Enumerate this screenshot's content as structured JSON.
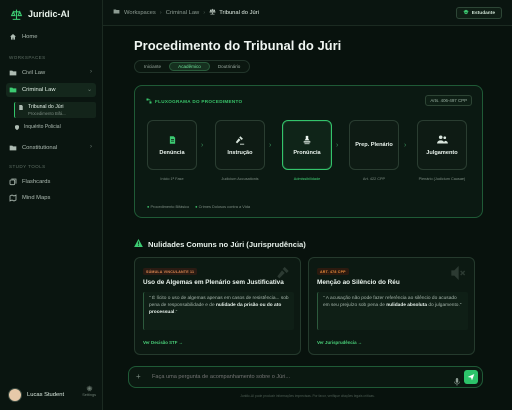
{
  "app": {
    "name": "Juridic-AI"
  },
  "sidebar": {
    "home": "Home",
    "workspaces_label": "WORKSPACES",
    "civil_law": "Civil Law",
    "criminal_law": "Criminal Law",
    "sub_items": [
      {
        "title": "Tribunal do Júri",
        "subtitle": "Procedimento Bifá..."
      },
      {
        "title": "Inquérito Policial",
        "subtitle": ""
      }
    ],
    "constitutional": "Constitutional",
    "study_tools_label": "STUDY TOOLS",
    "flashcards": "Flashcards",
    "mind_maps": "Mind Maps",
    "user_name": "Lucas Student",
    "settings_label": "Settings"
  },
  "topbar": {
    "breadcrumbs": [
      "Workspaces",
      "Criminal Law",
      "Tribunal do Júri"
    ],
    "mode_label": "Estudante"
  },
  "main": {
    "title": "Procedimento do Tribunal do Júri",
    "tabs": [
      {
        "label": "Iniciante",
        "active": false
      },
      {
        "label": "Acadêmico",
        "active": true
      },
      {
        "label": "Doutrinário",
        "active": false
      }
    ],
    "flowchart": {
      "title": "FLUXOGRAMA DO PROCEDIMENTO",
      "ref": "Arts. 406-497 CPP",
      "nodes": [
        {
          "label": "Denúncia",
          "sub": "Início 1ª Fase",
          "icon": "document-icon",
          "highlight": false
        },
        {
          "label": "Instrução",
          "sub": "Judicium Accusationis",
          "icon": "gavel-icon",
          "highlight": false
        },
        {
          "label": "Pronúncia",
          "sub": "Admissibilidade",
          "icon": "stamp-icon",
          "highlight": true
        },
        {
          "label": "Prep. Plenário",
          "sub": "Art. 422 CPP",
          "icon": "",
          "highlight": false
        },
        {
          "label": "Julgamento",
          "sub": "Plenário (Judicium Causae)",
          "icon": "people-icon",
          "highlight": false
        }
      ],
      "legend": [
        "Procedimento Bifásico",
        "Crimes Dolosos contra a Vida"
      ]
    },
    "nullities": {
      "title": "Nulidades Comuns no Júri (Jurisprudência)",
      "cards": [
        {
          "badge": "SÚMULA VINCULANTE 11",
          "title": "Uso de Algemas em Plenário sem Justificativa",
          "quote_pre": "\" É lícito o uso de algemas apenas em casos de resistência... sob pena de responsabilidade e de ",
          "quote_bold": "nulidade da prisão ou do ato processual",
          "quote_post": ".\"",
          "link": "Ver Decisão STF →"
        },
        {
          "badge": "ART. 478 CPP",
          "title": "Menção ao Silêncio do Réu",
          "quote_pre": "\" A acusação não pode fazer referência ao silêncio do acusado em seu prejuízo sob pena de ",
          "quote_bold": "nulidade absoluta",
          "quote_post": " do julgamento.\"",
          "link": "Ver Jurisprudência →"
        }
      ]
    },
    "chat": {
      "placeholder": "Faça uma pergunta de acompanhamento sobre o Júri...",
      "disclaimer": "Juridic-AI pode produzir informações imprecisas. Por favor, verifique citações legais críticas."
    }
  },
  "colors": {
    "accent": "#2cc46a",
    "background": "#07110c",
    "warning": "#e98b3a"
  }
}
